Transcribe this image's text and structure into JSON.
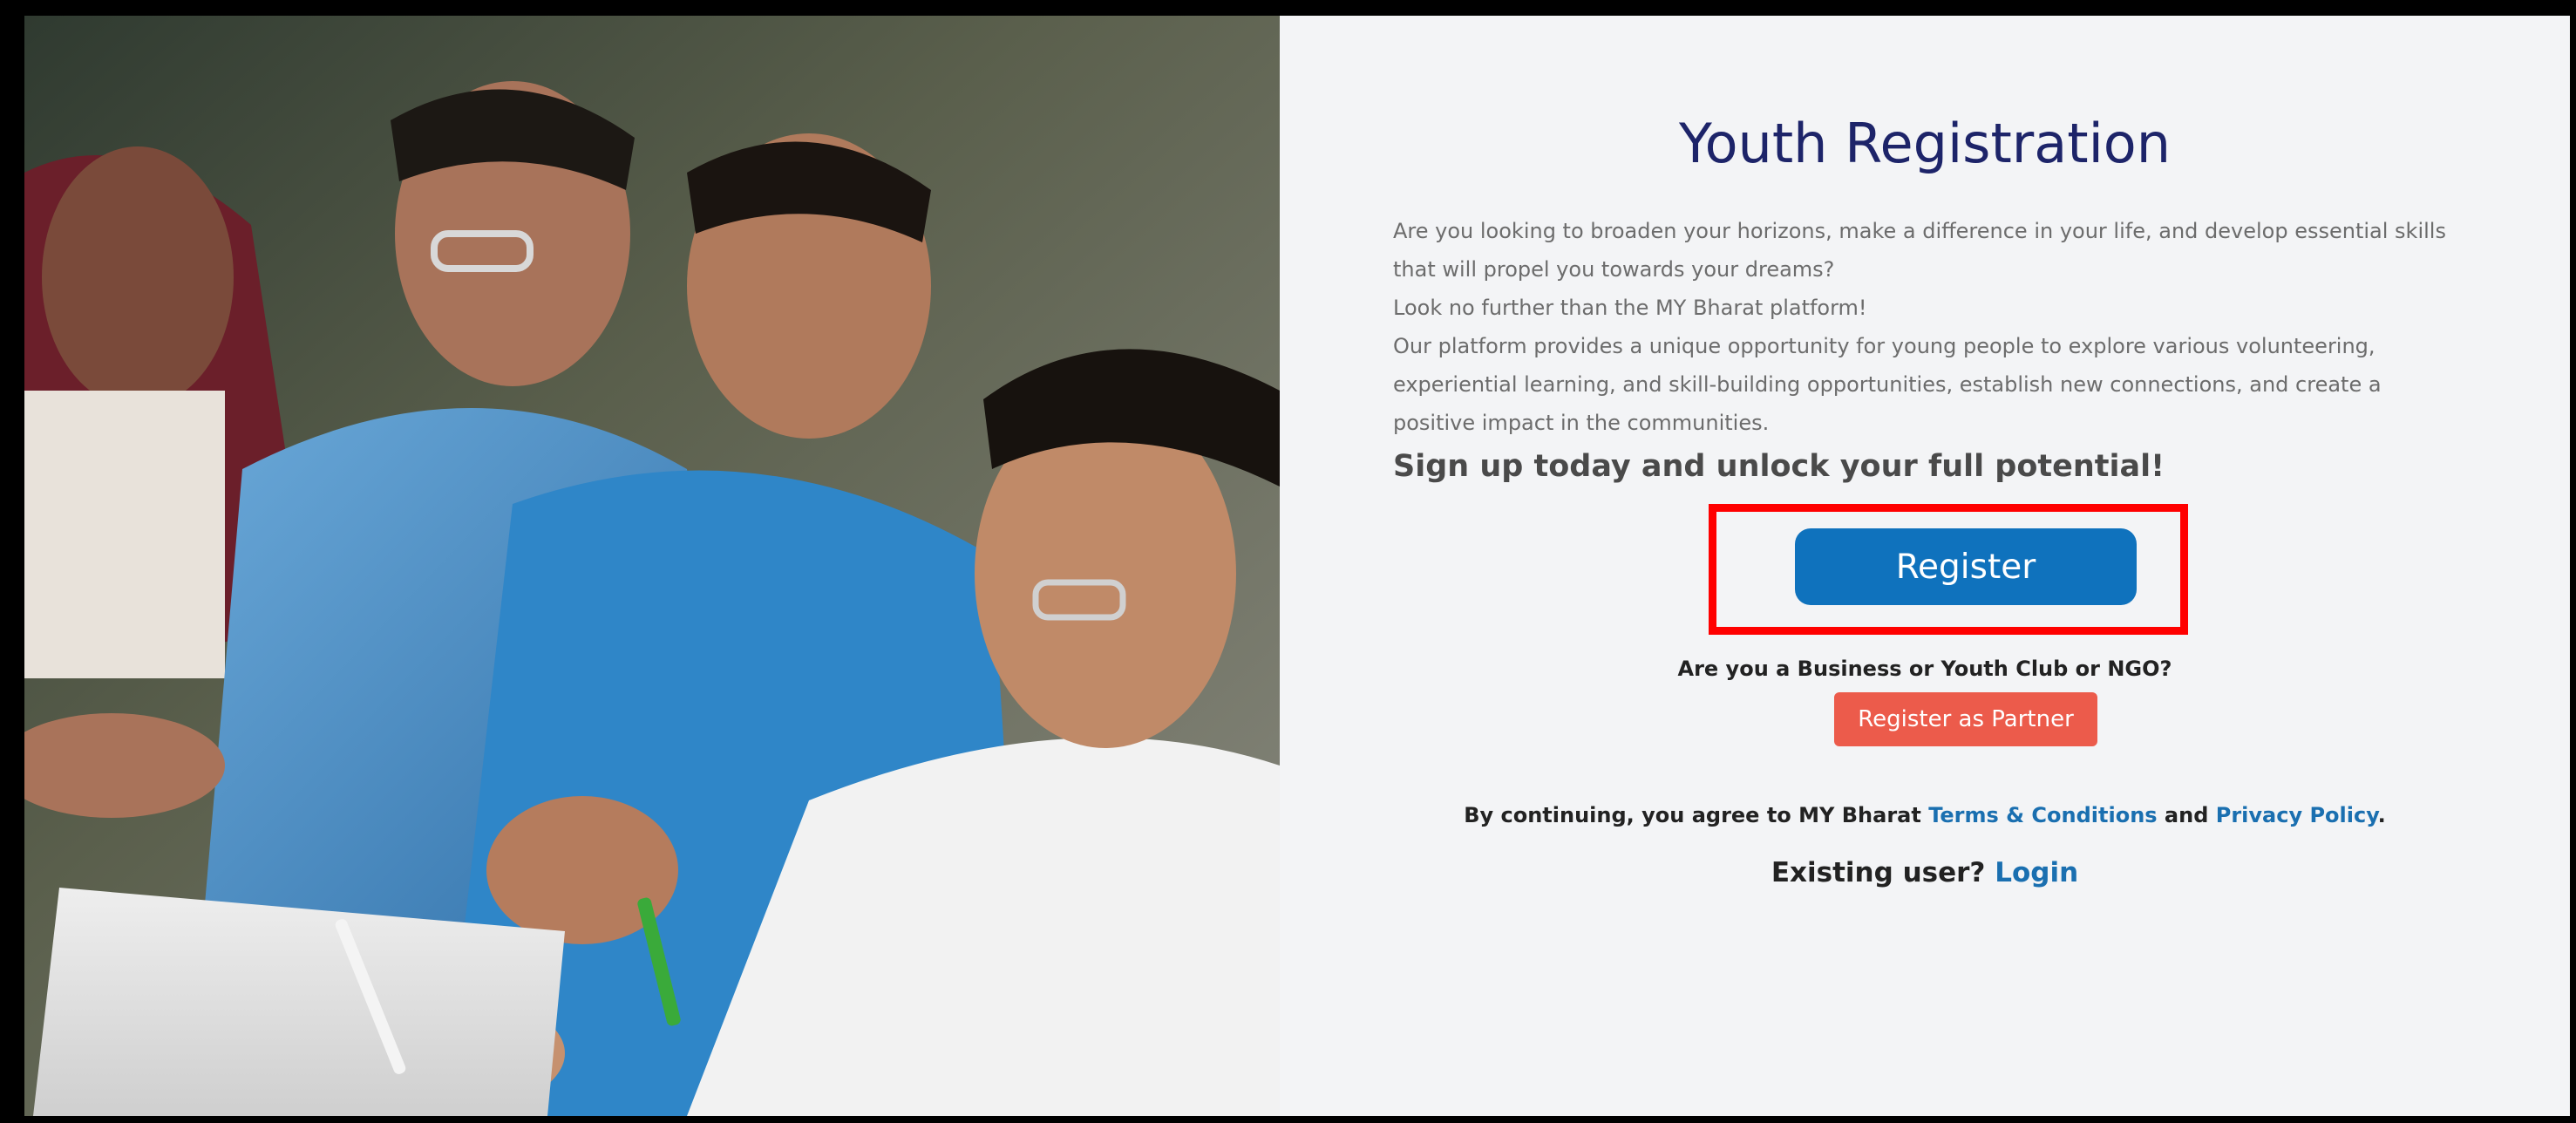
{
  "hero": {
    "image_name": "students-studying-photo"
  },
  "main": {
    "title": "Youth Registration",
    "intro_paragraphs": [
      "Are you looking to broaden your horizons, make a difference in your life, and develop essential skills that will propel you towards your dreams?",
      "Look no further than the MY Bharat platform!",
      "Our platform provides a unique opportunity for young people to explore various volunteering, experiential learning, and skill-building opportunities, establish new connections, and create a positive impact in the communities."
    ],
    "cta_heading": "Sign up today and unlock your full potential!",
    "register_button": "Register",
    "partner_question": "Are you a Business or Youth Club or NGO?",
    "partner_button": "Register as Partner",
    "terms": {
      "prefix": "By continuing, you agree to MY Bharat ",
      "terms_link": "Terms & Conditions",
      "middle": " and ",
      "privacy_link": "Privacy Policy",
      "suffix": "."
    },
    "login": {
      "prefix": "Existing user? ",
      "link": "Login"
    }
  },
  "colors": {
    "title": "#1d2469",
    "register_button_bg": "#0f72bd",
    "partner_button_bg": "#ec5b4b",
    "link": "#1a6fb0",
    "highlight_border": "#ff0000"
  }
}
